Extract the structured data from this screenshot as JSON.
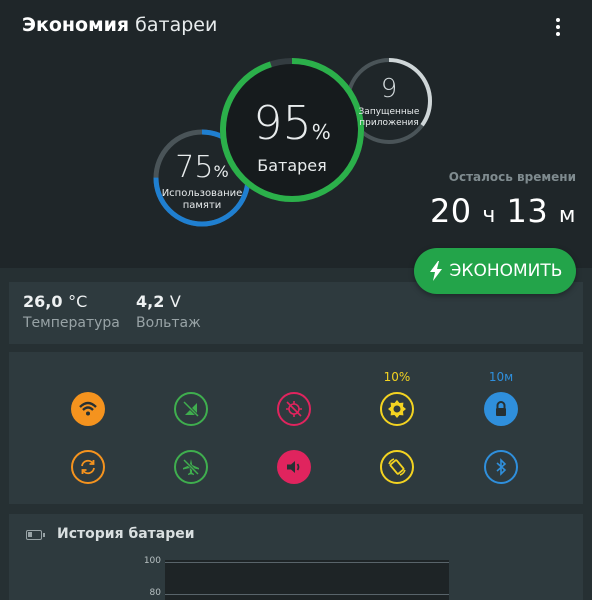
{
  "header": {
    "title_bold": "Экономия",
    "title_rest": "батареи",
    "time_label": "Осталось времени",
    "time_hours": "20",
    "time_hours_unit": "ч",
    "time_minutes": "13",
    "time_minutes_unit": "м",
    "save_button": "ЭКОНОМИТЬ"
  },
  "gauges": {
    "battery": {
      "value": "95",
      "unit": "%",
      "label": "Батарея",
      "level": 0.95,
      "color": "#2bb04a"
    },
    "memory": {
      "value": "75",
      "unit": "%",
      "label_line1": "Использование",
      "label_line2": "памяти",
      "level": 0.75,
      "color": "#1f7fd0"
    },
    "apps": {
      "value": "9",
      "label_line1": "Запущенные",
      "label_line2": "приложения",
      "level": 0.35,
      "color": "#cfd6d8"
    }
  },
  "stats": {
    "temperature": {
      "value": "26,0",
      "unit": "°C",
      "label": "Температура"
    },
    "voltage": {
      "value": "4,2",
      "unit": "V",
      "label": "Вольтаж"
    }
  },
  "toggles": {
    "brightness_caption": "10%",
    "lock_caption": "10м",
    "row1": [
      {
        "name": "wifi",
        "color": "#f5931e"
      },
      {
        "name": "mobile-data",
        "color": "#3fae4e"
      },
      {
        "name": "gps",
        "color": "#e0245e"
      },
      {
        "name": "brightness",
        "color": "#f3d321"
      },
      {
        "name": "screen-lock",
        "color": "#2f8fdc"
      }
    ],
    "row2": [
      {
        "name": "sync",
        "color": "#f5931e"
      },
      {
        "name": "airplane",
        "color": "#3fae4e"
      },
      {
        "name": "sound",
        "color": "#e0245e"
      },
      {
        "name": "rotation",
        "color": "#f3d321"
      },
      {
        "name": "bluetooth",
        "color": "#2f8fdc"
      }
    ]
  },
  "history": {
    "title": "История батареи",
    "tick_100": "100",
    "tick_80": "80"
  },
  "colors": {
    "header_bg": "#1f2629",
    "card_bg": "#2e3a3e",
    "accent_green": "#23a44a"
  }
}
